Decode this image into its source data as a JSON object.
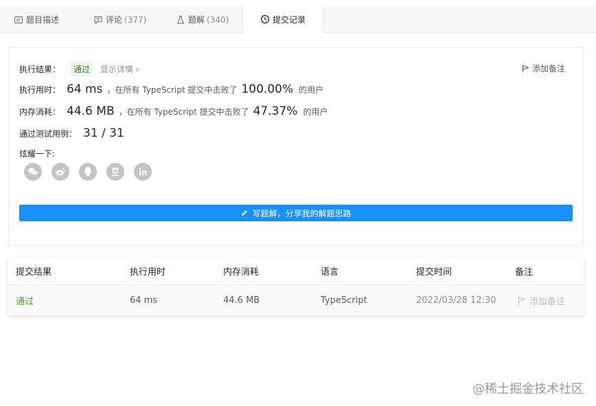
{
  "tabs": [
    {
      "label": "题目描述",
      "count": ""
    },
    {
      "label": "评论",
      "count": "(377)"
    },
    {
      "label": "题解",
      "count": "(340)"
    },
    {
      "label": "提交记录",
      "count": ""
    }
  ],
  "result": {
    "status_label": "执行结果：",
    "status": "通过",
    "detail": "显示详情 ›",
    "add_note": "添加备注",
    "runtime_label": "执行用时：",
    "runtime": "64 ms",
    "runtime_text": "，在所有 TypeScript 提交中击败了",
    "runtime_pct": "100.00%",
    "users_text": "的用户",
    "memory_label": "内存消耗：",
    "memory": "44.6 MB",
    "memory_text": "，在所有 TypeScript 提交中击败了",
    "memory_pct": "47.37%",
    "cases_label": "通过测试用例：",
    "cases": "31 / 31",
    "share_label": "炫耀一下:",
    "share_icons": [
      "wechat-icon",
      "weibo-icon",
      "qq-icon",
      "douban-icon",
      "linkedin-icon"
    ],
    "solve_button": "写题解，分享我的解题思路"
  },
  "table": {
    "headers": [
      "提交结果",
      "执行用时",
      "内存消耗",
      "语言",
      "提交时间",
      "备注"
    ],
    "rows": [
      {
        "result": "通过",
        "runtime": "64 ms",
        "memory": "44.6 MB",
        "language": "TypeScript",
        "time": "2022/03/28 12:30",
        "note": "添加备注"
      }
    ]
  },
  "watermark": "@稀土掘金技术社区",
  "colors": {
    "accent": "#1890ff",
    "success": "#52a531"
  }
}
